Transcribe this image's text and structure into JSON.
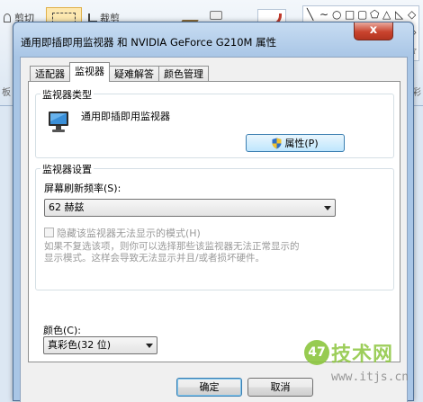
{
  "background_app": {
    "cut_label": "剪切",
    "crop_label": "裁剪",
    "left_group_label": "板",
    "right_group_label": "彩"
  },
  "dialog": {
    "title": "通用即插即用监视器 和 NVIDIA GeForce G210M 属性",
    "close_glyph": "x",
    "tabs": [
      {
        "label": "适配器",
        "active": false
      },
      {
        "label": "监视器",
        "active": true
      },
      {
        "label": "疑难解答",
        "active": false
      },
      {
        "label": "颜色管理",
        "active": false
      }
    ],
    "monitor_type": {
      "group_title": "监视器类型",
      "monitor_name": "通用即插即用监视器",
      "properties_button": "属性(P)"
    },
    "monitor_settings": {
      "group_title": "监视器设置",
      "refresh_label": "屏幕刷新频率(S):",
      "refresh_value": "62 赫兹",
      "hide_modes_label": "隐藏该监视器无法显示的模式(H)",
      "hide_modes_checked": false,
      "description_line1": "如果不复选该项，则你可以选择那些该监视器无法正常显示的",
      "description_line2": "显示模式。这样会导致无法显示并且/或者损坏硬件。"
    },
    "colors": {
      "label": "颜色(C):",
      "value": "真彩色(32 位)"
    },
    "buttons": {
      "ok": "确定",
      "cancel": "取消"
    }
  },
  "watermark": {
    "logo_glyph": "47",
    "site_text": "技术网",
    "url": "www.itjs.cn"
  },
  "colors": {
    "close_button": "#c9432e",
    "window_frame": "#a9c6e6",
    "watermark_green": "#8cc63f"
  }
}
